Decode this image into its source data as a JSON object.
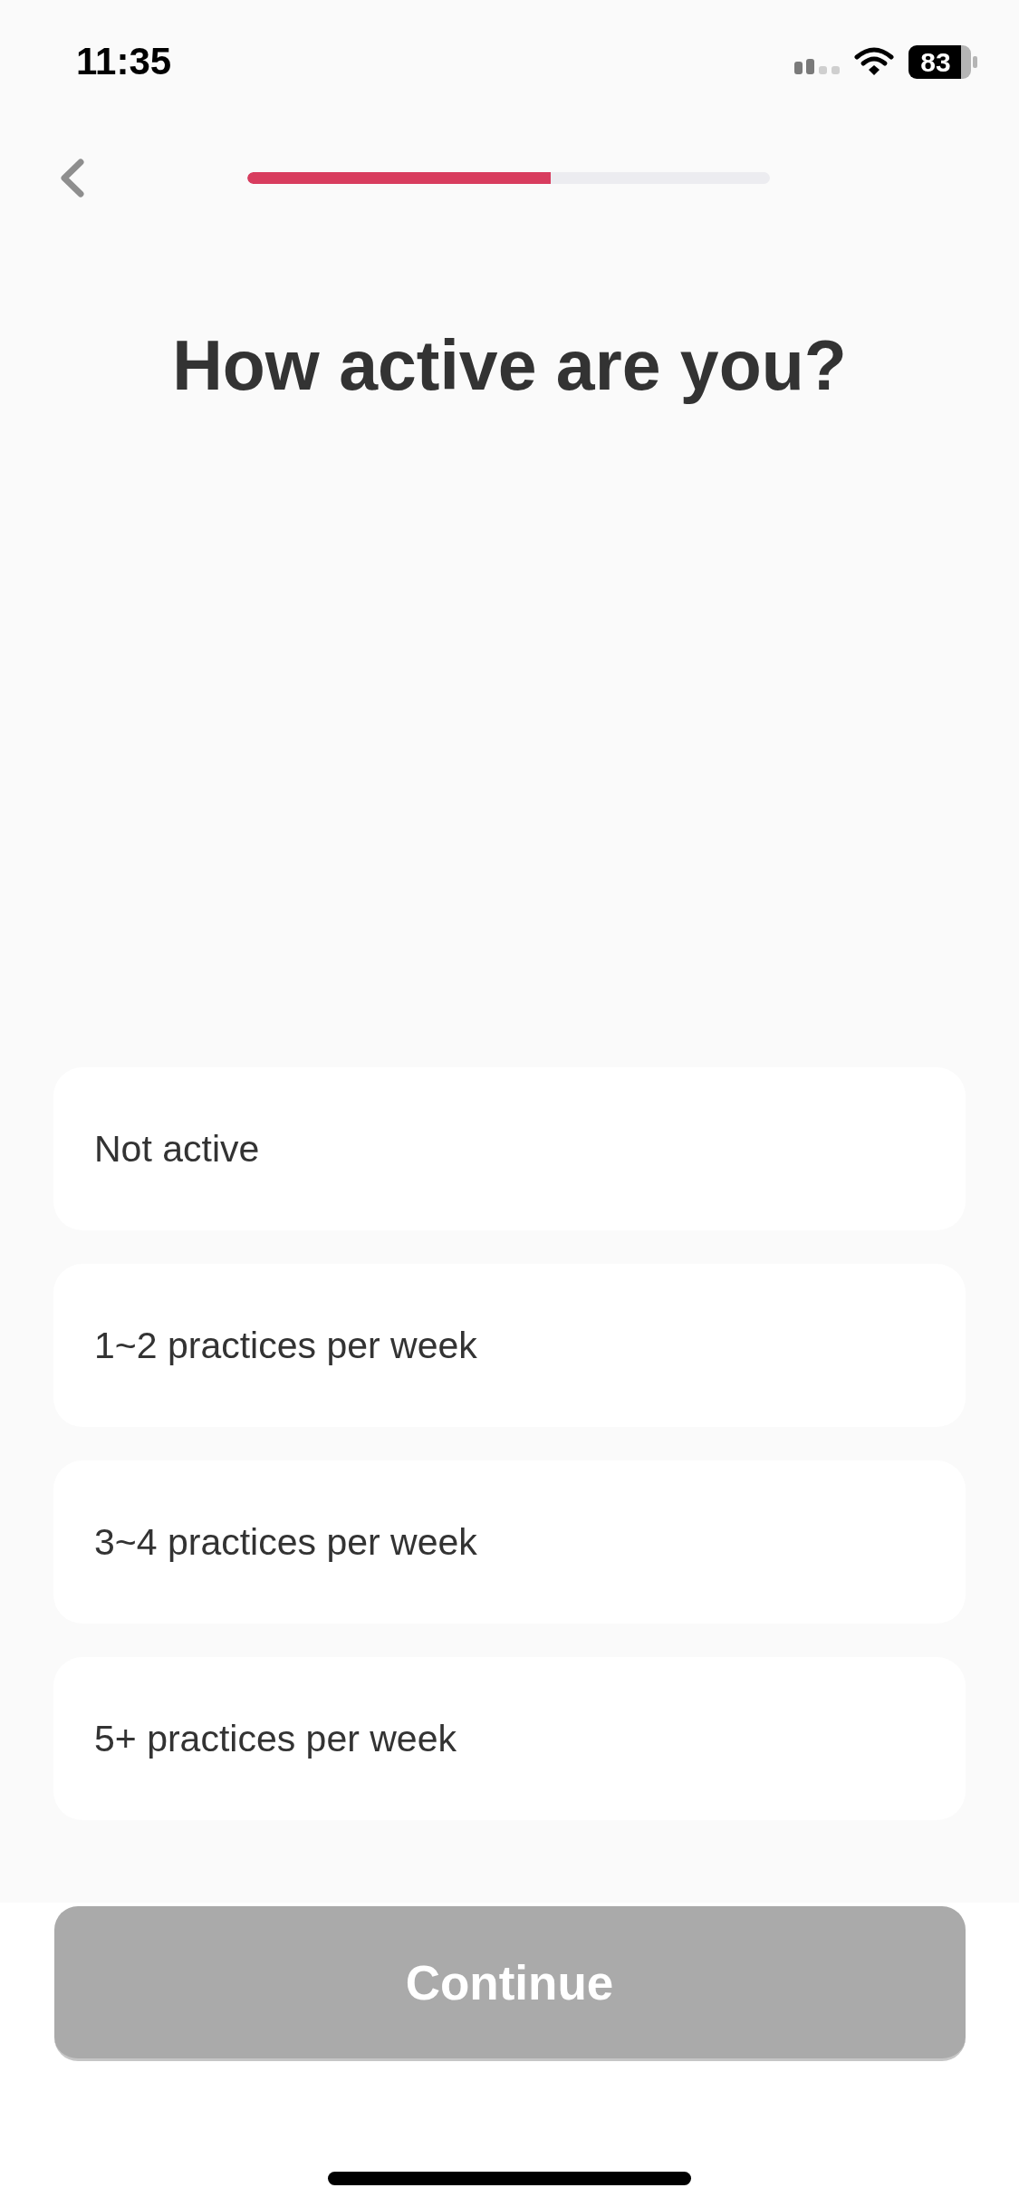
{
  "status_bar": {
    "time": "11:35",
    "battery": "83"
  },
  "header": {
    "progress": {
      "level": 0.58
    }
  },
  "title": "How active are you?",
  "options": [
    {
      "label": "Not active",
      "selected": false
    },
    {
      "label": "1~2 practices per week",
      "selected": false
    },
    {
      "label": "3~4 practices per week",
      "selected": false
    },
    {
      "label": "5+ practices per week",
      "selected": false
    }
  ],
  "continue_button": {
    "label": "Continue",
    "disabled": true
  }
}
